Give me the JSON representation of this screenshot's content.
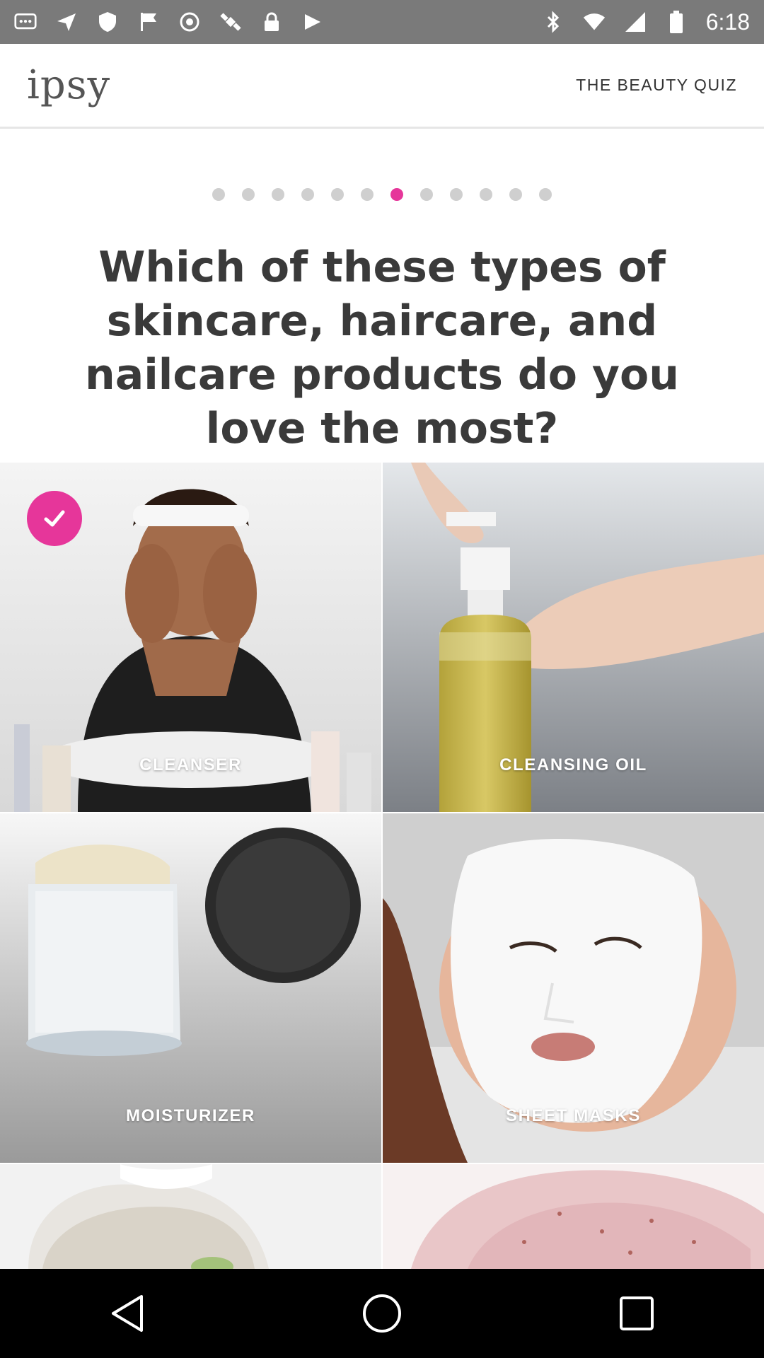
{
  "status_bar": {
    "time": "6:18",
    "left_icons": [
      "messages-icon",
      "send-icon",
      "shield-icon",
      "flag-icon",
      "circle-p-icon",
      "satellite-icon",
      "lock-icon",
      "play-store-icon"
    ],
    "right_icons": [
      "bluetooth-icon",
      "wifi-icon",
      "signal-icon",
      "battery-icon"
    ]
  },
  "header": {
    "logo": "ipsy",
    "quiz_link": "THE BEAUTY QUIZ"
  },
  "progress": {
    "total_steps": 12,
    "current_step": 7,
    "active_color": "#e6369a"
  },
  "question": {
    "text": "Which of these types of skincare, haircare, and nailcare products do you love the most?"
  },
  "options": [
    {
      "label": "CLEANSER",
      "selected": true
    },
    {
      "label": "CLEANSING OIL",
      "selected": false
    },
    {
      "label": "MOISTURIZER",
      "selected": false
    },
    {
      "label": "SHEET MASKS",
      "selected": false
    }
  ],
  "nav": {
    "icons": [
      "back-icon",
      "home-icon",
      "recents-icon"
    ]
  }
}
